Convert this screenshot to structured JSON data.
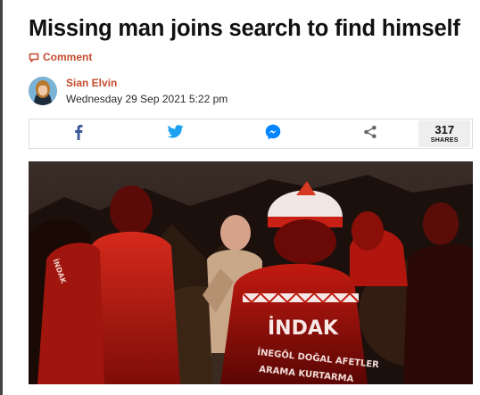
{
  "article": {
    "headline": "Missing man joins search to find himself",
    "comment_label": "Comment",
    "author": "Sian Elvin",
    "date": "Wednesday 29 Sep 2021 5:22 pm"
  },
  "share": {
    "facebook_icon": "facebook-icon",
    "twitter_icon": "twitter-icon",
    "messenger_icon": "messenger-icon",
    "share_icon": "share-icon",
    "count": "317",
    "count_label": "SHARES"
  },
  "photo": {
    "jacket_text_main": "İNDAK",
    "jacket_text_line1": "İNEGÖL DOĞAL AFETLER",
    "jacket_text_line2": "ARAMA KURTARMA",
    "sleeve_text": "İNDAK"
  },
  "colors": {
    "accent": "#c64c2c",
    "facebook": "#3b5998",
    "twitter": "#1da1f2",
    "messenger": "#0084ff"
  }
}
